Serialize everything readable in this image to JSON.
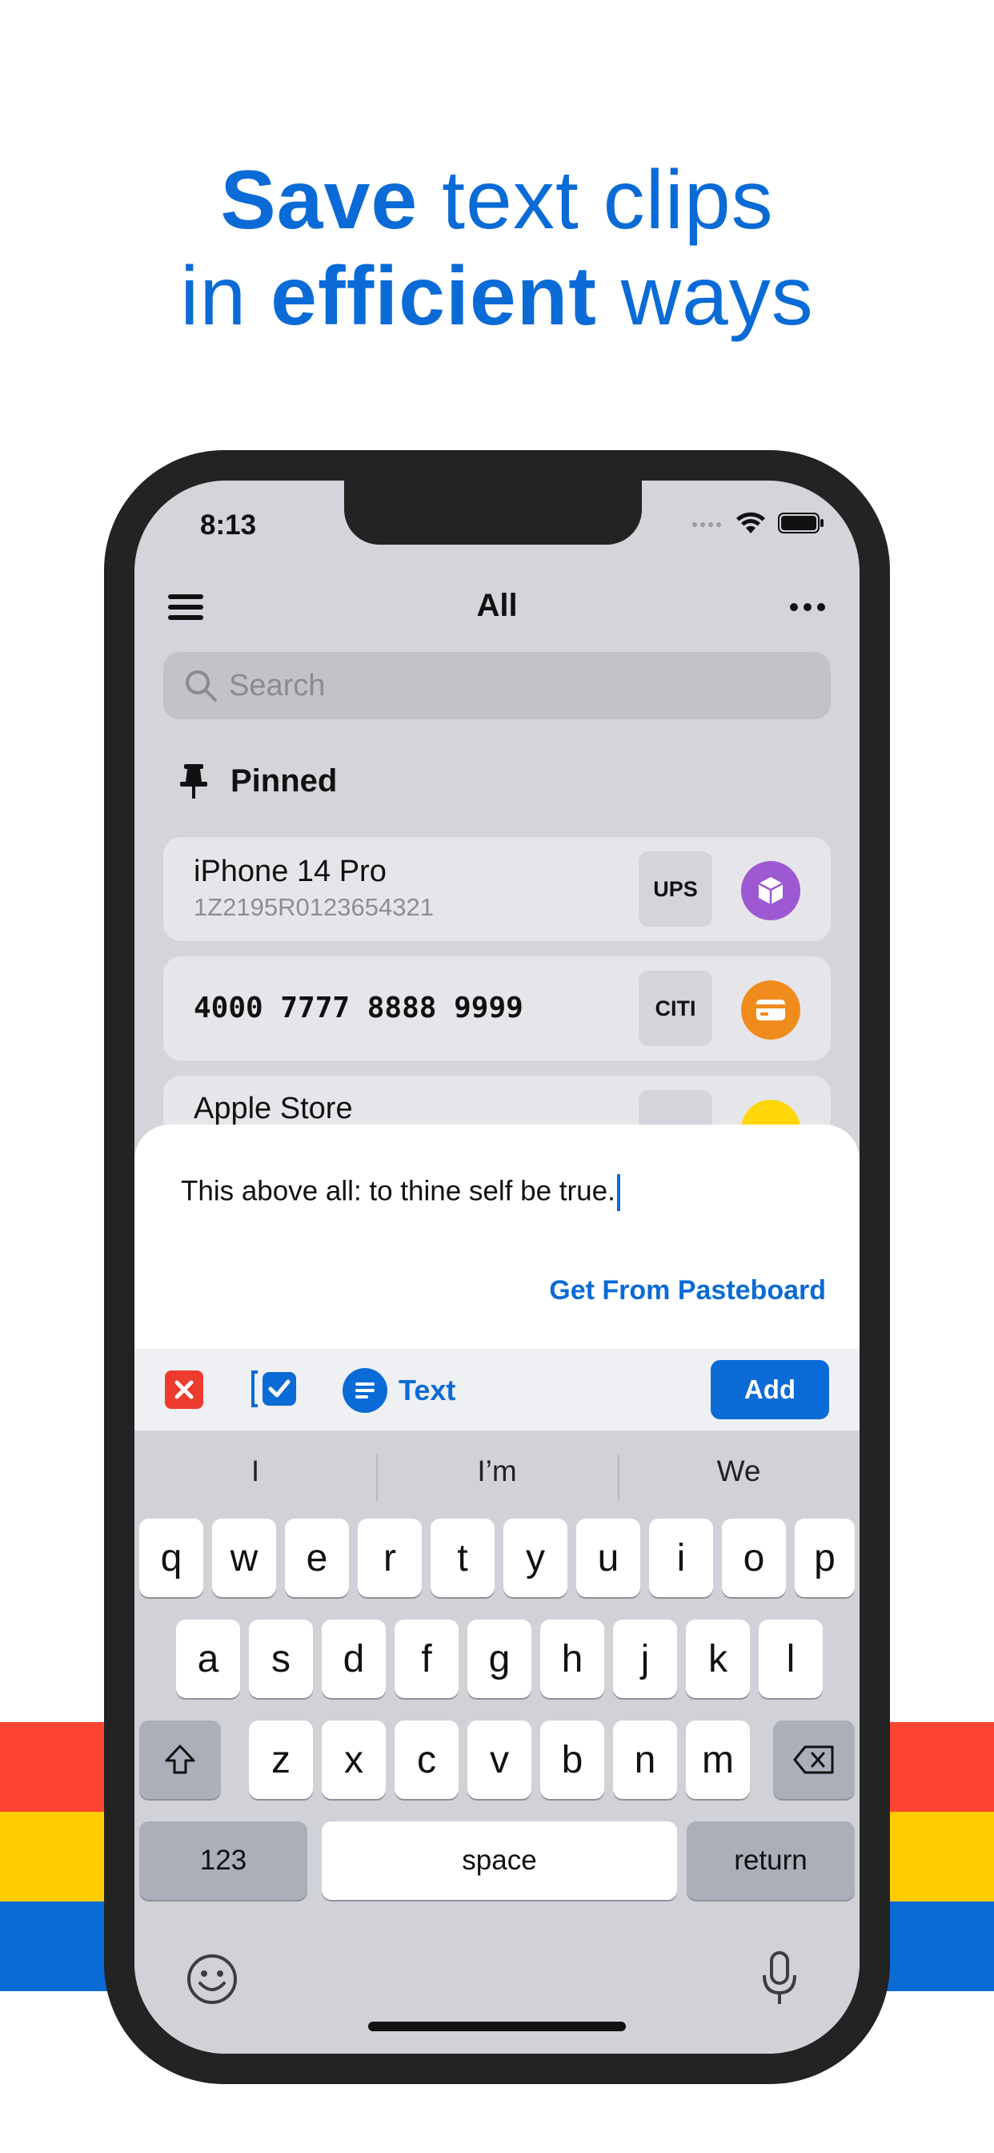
{
  "headline": {
    "line1_bold": "Save",
    "line1_rest": " text clips",
    "line2_start": "in ",
    "line2_bold": "efficient",
    "line2_rest": " ways"
  },
  "colors": {
    "accent": "#0b6bd6",
    "stripe_red": "#ff4433",
    "stripe_yellow": "#ffcc00",
    "stripe_blue": "#0b6bd6",
    "ups_purple": "#9c59d1",
    "citi_orange": "#f08c1e",
    "store_yellow": "#ffd60a"
  },
  "status_bar": {
    "time": "8:13"
  },
  "navbar": {
    "title": "All"
  },
  "search": {
    "placeholder": "Search"
  },
  "pinned_section": {
    "label": "Pinned"
  },
  "clips": [
    {
      "title": "iPhone 14 Pro",
      "subtitle": "1Z2195R0123654321",
      "tag": "UPS",
      "icon": "package-icon"
    },
    {
      "title": "4000 7777 8888 9999",
      "subtitle": "",
      "tag": "CITI",
      "icon": "credit-card-icon"
    },
    {
      "title": "Apple Store",
      "subtitle": "",
      "tag": "",
      "icon": "building-icon"
    }
  ],
  "editor": {
    "text": "This above all: to thine self be true.",
    "pasteboard_link": "Get From Pasteboard"
  },
  "toolbar": {
    "type_label": "Text",
    "add_label": "Add"
  },
  "keyboard": {
    "predictions": [
      "I",
      "I’m",
      "We"
    ],
    "row1": [
      "q",
      "w",
      "e",
      "r",
      "t",
      "y",
      "u",
      "i",
      "o",
      "p"
    ],
    "row2": [
      "a",
      "s",
      "d",
      "f",
      "g",
      "h",
      "j",
      "k",
      "l"
    ],
    "row3": [
      "z",
      "x",
      "c",
      "v",
      "b",
      "n",
      "m"
    ],
    "numbers_label": "123",
    "space_label": "space",
    "return_label": "return"
  }
}
